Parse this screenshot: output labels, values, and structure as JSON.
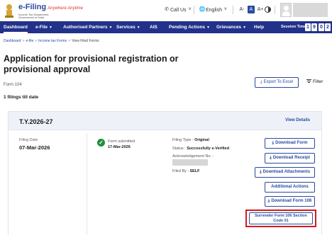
{
  "header": {
    "logo_title": "e-Filing",
    "logo_hindi": "Anywhere Anytime",
    "logo_sub1": "Income Tax Department,",
    "logo_sub2": "Government of India",
    "call_us": "Call Us",
    "language": "English",
    "text_size": [
      "A-",
      "A",
      "A+"
    ]
  },
  "nav": {
    "items": [
      "Dashboard",
      "e-File",
      "Authorised Partners",
      "Services",
      "AIS",
      "Pending Actions",
      "Grievances",
      "Help"
    ],
    "active": "Dashboard",
    "session_label": "Session Time",
    "session_digits": [
      "1",
      "9",
      "0",
      "2"
    ]
  },
  "breadcrumb": [
    "Dashboard",
    "e-file",
    "Income tax Forms",
    "View Filed Forms"
  ],
  "page": {
    "title": "Application for provisional registration or provisional approval",
    "form_number": "Form 104",
    "filings_count": "1 filings till date",
    "export_label": "Export To Excel",
    "filter_label": "Filter"
  },
  "card": {
    "year": "T.Y.2026-27",
    "view_details": "View Details",
    "filing_date_label": "Filing Date",
    "filing_date": "07-Mar-2026",
    "status_title": "Form submitted",
    "status_date": "17-Mar-2026",
    "filing_type_label": "Filing Type :",
    "filing_type": "Original",
    "status_label": "Status :",
    "status_value": "Successfully e-Verified",
    "ack_label": "Acknowledgement No. :",
    "filed_by_label": "Filed By :",
    "filed_by": "SELF",
    "actions": [
      "Download Form",
      "Download Receipt",
      "Download Attachments",
      "Additional Actions",
      "Download Form 106"
    ],
    "surrender_line1": "Surrender Form 106 Section",
    "surrender_line2": "Code 01"
  },
  "colors": {
    "nav_bg": "#22318a",
    "accent": "#2a4aa0",
    "success": "#1f8f3a",
    "highlight": "#d7191f"
  }
}
